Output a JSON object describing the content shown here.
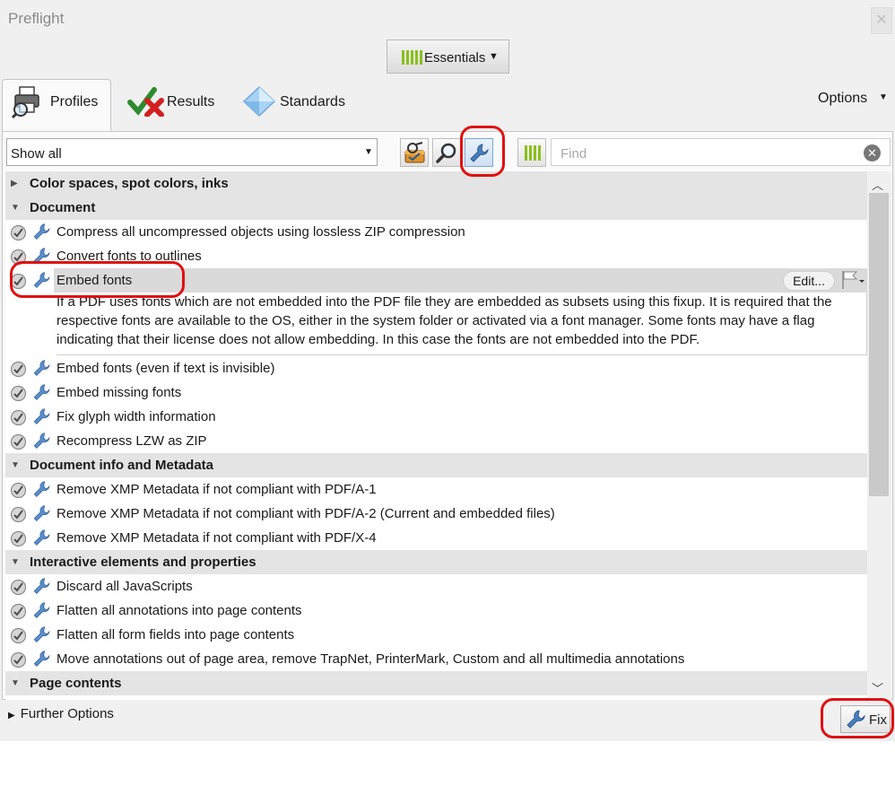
{
  "window": {
    "title": "Preflight",
    "close_icon": "close-icon"
  },
  "workspace": {
    "label": "Essentials",
    "icon": "bars-icon"
  },
  "tabs": [
    {
      "label": "Profiles",
      "icon": "printer-magnifier-icon",
      "selected": true
    },
    {
      "label": "Results",
      "icon": "check-cross-icon"
    },
    {
      "label": "Standards",
      "icon": "diamond-icon"
    }
  ],
  "options_label": "Options",
  "filter": {
    "selected": "Show all"
  },
  "toolbar": {
    "buttons": [
      "profiles-toolbox-icon",
      "magnifier-icon",
      "wrench-icon",
      "bars-icon"
    ],
    "active": "wrench-icon"
  },
  "search": {
    "placeholder": "Find"
  },
  "list": {
    "sections": [
      {
        "label": "Color spaces, spot colors, inks",
        "expanded": false,
        "items": []
      },
      {
        "label": "Document",
        "expanded": true,
        "items": [
          "Compress all uncompressed objects using lossless ZIP compression",
          "Convert fonts to outlines",
          "Embed fonts",
          "Embed fonts (even if text is invisible)",
          "Embed missing fonts",
          "Fix glyph width information",
          "Recompress LZW as ZIP"
        ]
      },
      {
        "label": "Document info and Metadata",
        "expanded": true,
        "items": [
          "Remove XMP Metadata if not compliant with PDF/A-1",
          "Remove XMP Metadata if not compliant with PDF/A-2 (Current and embedded files)",
          "Remove XMP Metadata if not compliant with PDF/X-4"
        ]
      },
      {
        "label": "Interactive elements and properties",
        "expanded": true,
        "items": [
          "Discard all JavaScripts",
          "Flatten all annotations into page contents",
          "Flatten all form fields into page contents",
          "Move annotations out of page area, remove TrapNet, PrinterMark, Custom and all multimedia annotations"
        ]
      },
      {
        "label": "Page contents",
        "expanded": true,
        "items": []
      }
    ],
    "selected_item": "Embed fonts",
    "edit_label": "Edit...",
    "selected_description": "If a PDF uses fonts which are not embedded into the PDF file they are embedded as subsets using this fixup. It is required that the respective fonts are available to the OS, either in the system folder or activated via a font manager. Some fonts may have a flag indicating that their license does not allow embedding. In this case the fonts are not embedded into the PDF."
  },
  "footer": {
    "further_options": "Further Options",
    "fix_label": "Fix"
  },
  "colors": {
    "annotation_red": "#e01010",
    "wrench_blue": "#4a7fbf",
    "bars_green": "#8bbf1d"
  }
}
